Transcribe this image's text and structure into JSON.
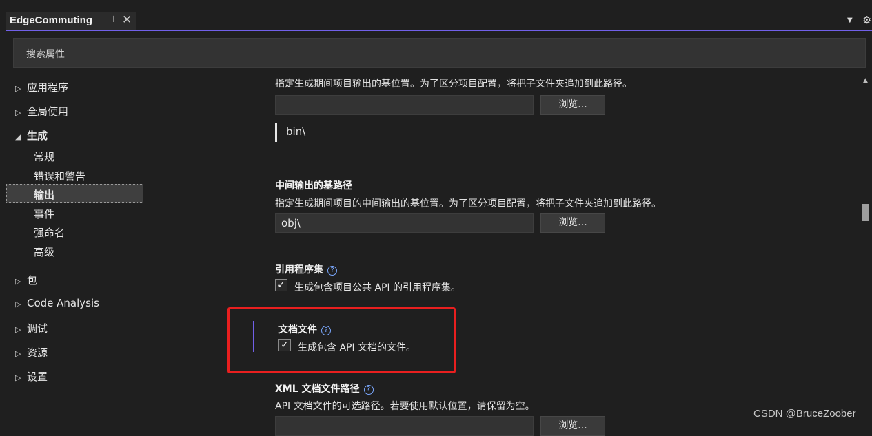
{
  "tab": {
    "title": "EdgeCommuting",
    "pin_glyph": "⊣",
    "close_glyph": "✕"
  },
  "search": {
    "placeholder": "搜索属性"
  },
  "sidebar": {
    "items": [
      {
        "label": "应用程序",
        "expanded": false
      },
      {
        "label": "全局使用",
        "expanded": false
      },
      {
        "label": "生成",
        "expanded": true,
        "children": [
          "常规",
          "错误和警告",
          "输出",
          "事件",
          "强命名",
          "高级"
        ],
        "selected": "输出"
      },
      {
        "label": "包",
        "expanded": false
      },
      {
        "label": "Code Analysis",
        "expanded": false
      },
      {
        "label": "调试",
        "expanded": false
      },
      {
        "label": "资源",
        "expanded": false
      },
      {
        "label": "设置",
        "expanded": false
      }
    ]
  },
  "content": {
    "base_output": {
      "description": "指定生成期间项目输出的基位置。为了区分项目配置，将把子文件夹追加到此路径。",
      "value": "",
      "browse_label": "浏览...",
      "effective_value": "bin\\"
    },
    "intermediate_output": {
      "heading": "中间输出的基路径",
      "description": "指定生成期间项目的中间输出的基位置。为了区分项目配置，将把子文件夹追加到此路径。",
      "value": "obj\\",
      "browse_label": "浏览..."
    },
    "reference_assembly": {
      "heading": "引用程序集",
      "checkbox_label": "生成包含项目公共 API 的引用程序集。",
      "checked": true
    },
    "documentation_file": {
      "heading": "文档文件",
      "checkbox_label": "生成包含 API 文档的文件。",
      "checked": true
    },
    "xml_doc_path": {
      "heading": "XML 文档文件路径",
      "description": "API 文档文件的可选路径。若要使用默认位置，请保留为空。",
      "browse_label": "浏览..."
    }
  },
  "watermark": "CSDN @BruceZoober",
  "colors": {
    "accent": "#7160e8",
    "highlight_box": "#e81f1f",
    "background": "#1f1f1f"
  }
}
